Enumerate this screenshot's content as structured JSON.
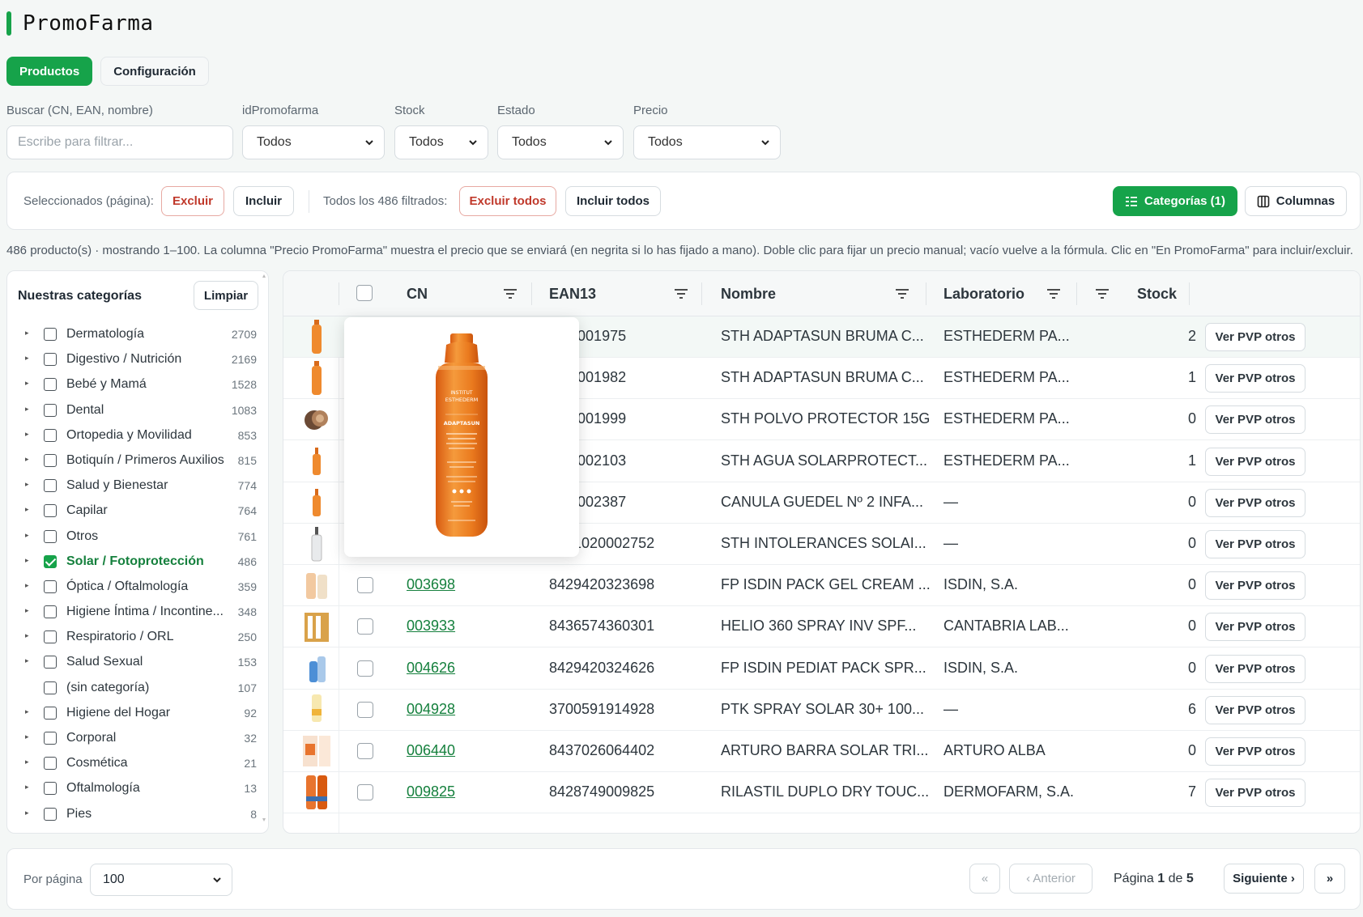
{
  "app": {
    "title": "PromoFarma"
  },
  "tabs": [
    {
      "label": "Productos",
      "active": true
    },
    {
      "label": "Configuración",
      "active": false
    }
  ],
  "filters": {
    "search": {
      "label": "Buscar (CN, EAN, nombre)",
      "placeholder": "Escribe para filtrar..."
    },
    "id": {
      "label": "idPromofarma",
      "value": "Todos"
    },
    "stock": {
      "label": "Stock",
      "value": "Todos"
    },
    "estado": {
      "label": "Estado",
      "value": "Todos"
    },
    "precio": {
      "label": "Precio",
      "value": "Todos"
    }
  },
  "toolbar": {
    "selected_label": "Seleccionados (página):",
    "exclude": "Excluir",
    "include": "Incluir",
    "all_label": "Todos los 486 filtrados:",
    "exclude_all": "Excluir todos",
    "include_all": "Incluir todos",
    "categories": "Categorías (1)",
    "columns": "Columnas"
  },
  "info_text": "486 producto(s) · mostrando 1–100. La columna \"Precio PromoFarma\" muestra el precio que se enviará (en negrita si lo has fijado a mano). Doble clic para fijar un precio manual; vacío vuelve a la fórmula. Clic en \"En PromoFarma\" para incluir/excluir.",
  "sidebar": {
    "title": "Nuestras categorías",
    "clear": "Limpiar",
    "categories": [
      {
        "name": "Dermatología",
        "count": "2709",
        "checked": false,
        "arrow": true
      },
      {
        "name": "Digestivo / Nutrición",
        "count": "2169",
        "checked": false,
        "arrow": true
      },
      {
        "name": "Bebé y Mamá",
        "count": "1528",
        "checked": false,
        "arrow": true
      },
      {
        "name": "Dental",
        "count": "1083",
        "checked": false,
        "arrow": true
      },
      {
        "name": "Ortopedia y Movilidad",
        "count": "853",
        "checked": false,
        "arrow": true
      },
      {
        "name": "Botiquín / Primeros Auxilios",
        "count": "815",
        "checked": false,
        "arrow": true
      },
      {
        "name": "Salud y Bienestar",
        "count": "774",
        "checked": false,
        "arrow": true
      },
      {
        "name": "Capilar",
        "count": "764",
        "checked": false,
        "arrow": true
      },
      {
        "name": "Otros",
        "count": "761",
        "checked": false,
        "arrow": true
      },
      {
        "name": "Solar / Fotoprotección",
        "count": "486",
        "checked": true,
        "arrow": true
      },
      {
        "name": "Óptica / Oftalmología",
        "count": "359",
        "checked": false,
        "arrow": true
      },
      {
        "name": "Higiene Íntima / Incontine...",
        "count": "348",
        "checked": false,
        "arrow": true
      },
      {
        "name": "Respiratorio / ORL",
        "count": "250",
        "checked": false,
        "arrow": true
      },
      {
        "name": "Salud Sexual",
        "count": "153",
        "checked": false,
        "arrow": true
      },
      {
        "name": "(sin categoría)",
        "count": "107",
        "checked": false,
        "arrow": false
      },
      {
        "name": "Higiene del Hogar",
        "count": "92",
        "checked": false,
        "arrow": true
      },
      {
        "name": "Corporal",
        "count": "32",
        "checked": false,
        "arrow": true
      },
      {
        "name": "Cosmética",
        "count": "21",
        "checked": false,
        "arrow": true
      },
      {
        "name": "Oftalmología",
        "count": "13",
        "checked": false,
        "arrow": true
      },
      {
        "name": "Pies",
        "count": "8",
        "checked": false,
        "arrow": true
      }
    ]
  },
  "table": {
    "columns": {
      "cn": "CN",
      "ean": "EAN13",
      "nombre": "Nombre",
      "lab": "Laboratorio",
      "stock": "Stock"
    },
    "pvp_label": "Ver PVP otros",
    "rows": [
      {
        "cn": "",
        "ean": ".022001975",
        "nombre": "STH ADAPTASUN BRUMA C...",
        "lab": "ESTHEDERM PA...",
        "stock": "2",
        "thumb": "bottle-orange"
      },
      {
        "cn": "",
        "ean": ".022001982",
        "nombre": "STH ADAPTASUN BRUMA C...",
        "lab": "ESTHEDERM PA...",
        "stock": "1",
        "thumb": "bottle-orange"
      },
      {
        "cn": "",
        "ean": ".022001999",
        "nombre": "STH POLVO PROTECTOR 15G",
        "lab": "ESTHEDERM PA...",
        "stock": "0",
        "thumb": "powder"
      },
      {
        "cn": "",
        "ean": ".020002103",
        "nombre": "STH AGUA SOLARPROTECT...",
        "lab": "ESTHEDERM PA...",
        "stock": "1",
        "thumb": "bottle-small"
      },
      {
        "cn": "",
        "ean": ".020002387",
        "nombre": "CANULA GUEDEL Nº 2 INFA...",
        "lab": "—",
        "stock": "0",
        "thumb": "bottle-small"
      },
      {
        "cn": "002752",
        "ean": "3461020002752",
        "nombre": "STH INTOLERANCES SOLAI...",
        "lab": "—",
        "stock": "0",
        "thumb": "bottle-white"
      },
      {
        "cn": "003698",
        "ean": "8429420323698",
        "nombre": "FP ISDIN PACK GEL CREAM ...",
        "lab": "ISDIN, S.A.",
        "stock": "0",
        "thumb": "pack"
      },
      {
        "cn": "003933",
        "ean": "8436574360301",
        "nombre": "HELIO 360 SPRAY INV SPF...",
        "lab": "CANTABRIA LAB...",
        "stock": "0",
        "thumb": "box"
      },
      {
        "cn": "004626",
        "ean": "8429420324626",
        "nombre": "FP ISDIN PEDIAT PACK SPR...",
        "lab": "ISDIN, S.A.",
        "stock": "0",
        "thumb": "pack-blue"
      },
      {
        "cn": "004928",
        "ean": "3700591914928",
        "nombre": "PTK SPRAY SOLAR 30+ 100...",
        "lab": "—",
        "stock": "6",
        "thumb": "tube"
      },
      {
        "cn": "006440",
        "ean": "8437026064402",
        "nombre": "ARTURO BARRA SOLAR TRI...",
        "lab": "ARTURO ALBA",
        "stock": "0",
        "thumb": "box-orange"
      },
      {
        "cn": "009825",
        "ean": "8428749009825",
        "nombre": "RILASTIL DUPLO DRY TOUC...",
        "lab": "DERMOFARM, S.A.",
        "stock": "7",
        "thumb": "duo"
      }
    ]
  },
  "popover": {
    "brand": "ESTHEDERM",
    "brand_top": "INSTITUT",
    "product": "ADAPTASUN"
  },
  "pagination": {
    "per_page_label": "Por página",
    "per_page": "100",
    "first": "«",
    "prev": "‹ Anterior",
    "page_prefix": "Página",
    "page_current": "1",
    "page_of": "de",
    "page_total": "5",
    "next": "Siguiente ›",
    "last": "»"
  },
  "colors": {
    "accent": "#16a34a",
    "link": "#15803d",
    "danger": "#c0392b"
  }
}
